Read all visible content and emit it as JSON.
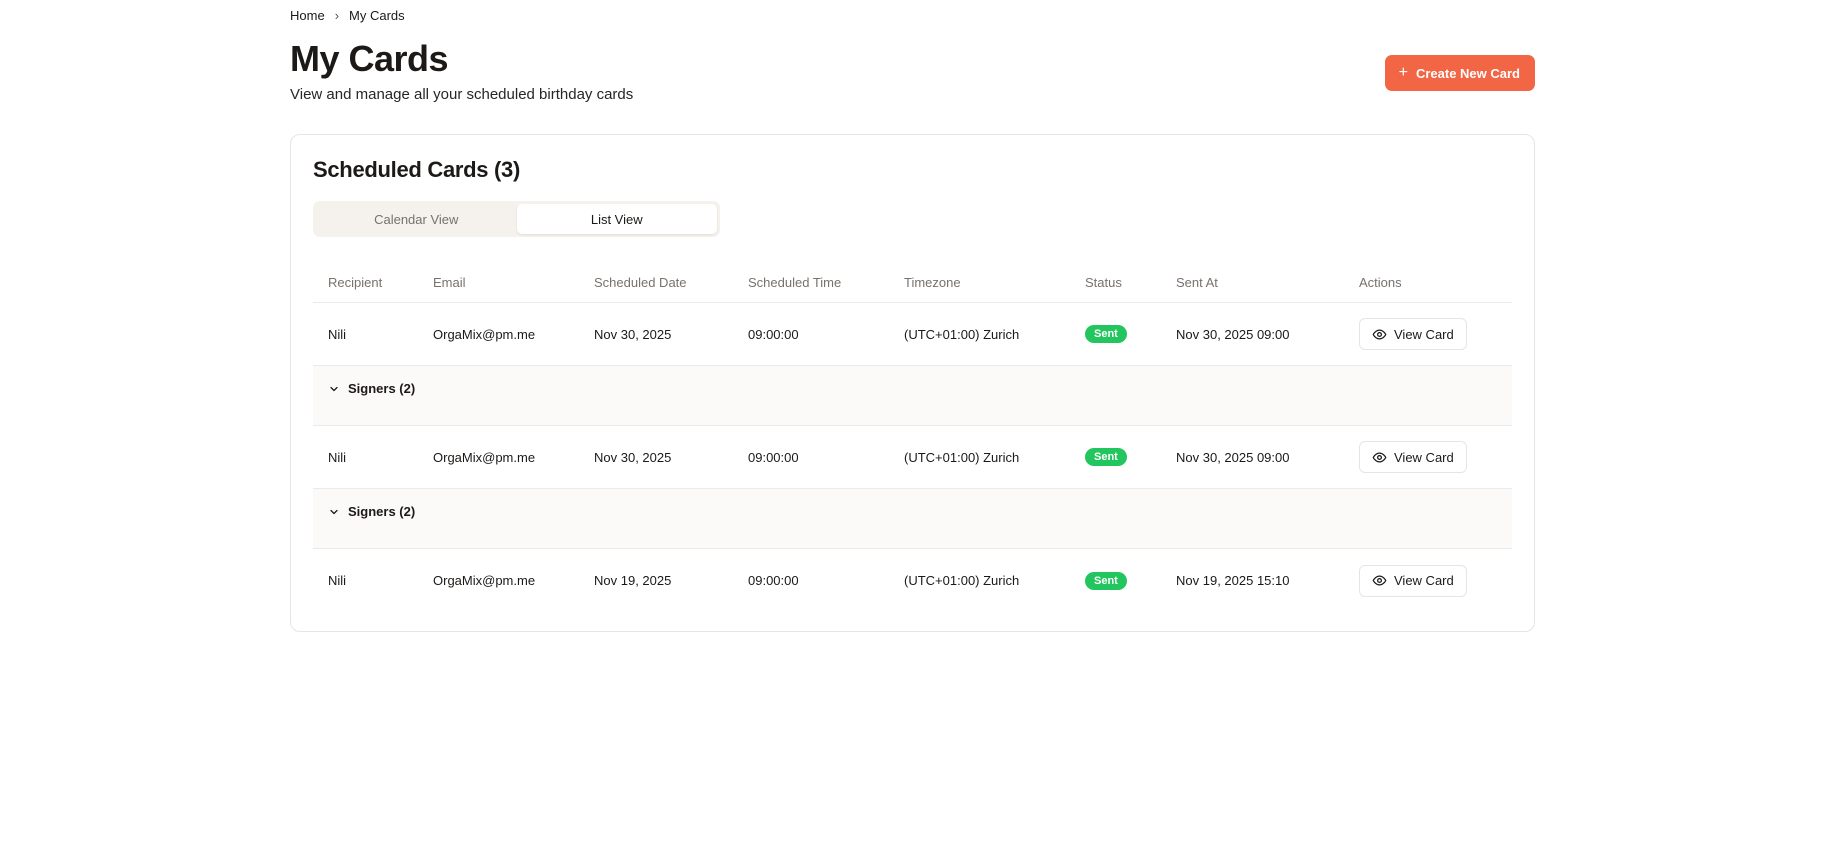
{
  "breadcrumb": {
    "home": "Home",
    "separator": "›",
    "current": "My Cards"
  },
  "header": {
    "title": "My Cards",
    "subtitle": "View and manage all your scheduled birthday cards",
    "create_button": "Create New Card",
    "create_button_icon": "plus-icon"
  },
  "card": {
    "title": "Scheduled Cards (3)",
    "tabs": {
      "calendar": "Calendar View",
      "list": "List View",
      "active": "list"
    }
  },
  "table": {
    "columns": {
      "recipient": "Recipient",
      "email": "Email",
      "date": "Scheduled Date",
      "time": "Scheduled Time",
      "timezone": "Timezone",
      "status": "Status",
      "sent_at": "Sent At",
      "actions": "Actions"
    },
    "rows": [
      {
        "recipient": "Nili",
        "email": "OrgaMix@pm.me",
        "date": "Nov 30, 2025",
        "time": "09:00:00",
        "timezone": "(UTC+01:00) Zurich",
        "status": "Sent",
        "sent_at": "Nov 30, 2025 09:00",
        "action": "View Card",
        "signers": "Signers (2)"
      },
      {
        "recipient": "Nili",
        "email": "OrgaMix@pm.me",
        "date": "Nov 30, 2025",
        "time": "09:00:00",
        "timezone": "(UTC+01:00) Zurich",
        "status": "Sent",
        "sent_at": "Nov 30, 2025 09:00",
        "action": "View Card",
        "signers": "Signers (2)"
      },
      {
        "recipient": "Nili",
        "email": "OrgaMix@pm.me",
        "date": "Nov 19, 2025",
        "time": "09:00:00",
        "timezone": "(UTC+01:00) Zurich",
        "status": "Sent",
        "sent_at": "Nov 19, 2025 15:10",
        "action": "View Card"
      }
    ]
  },
  "colors": {
    "accent": "#f26645",
    "status_sent": "#22c55e"
  }
}
